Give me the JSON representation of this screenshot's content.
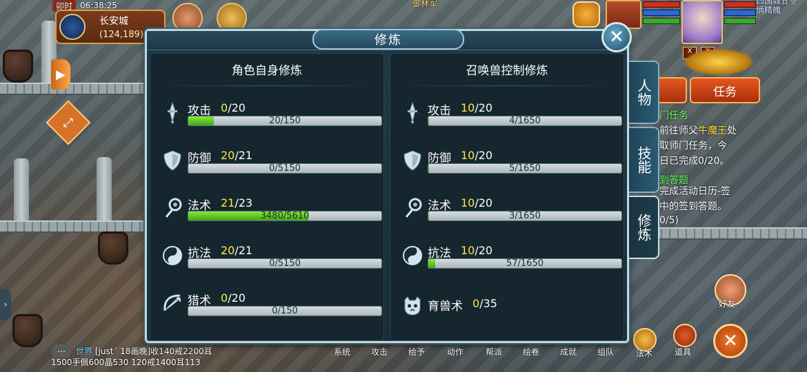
{
  "hud": {
    "shichen": "卯时",
    "clock": "06:38:25",
    "city": "长安城",
    "coords": "(124,189)",
    "top_mid_text": "御林军",
    "top_right_text_1": "四国城甘冬",
    "top_right_text_2": "炳精魄"
  },
  "quests": {
    "task_tab": "任务",
    "q1_title": "门任务",
    "q1_l1_a": "前往师父",
    "q1_l1_npc": "牛魔王",
    "q1_l1_b": "处",
    "q1_l2": "取师门任务，今",
    "q1_l3": "日已完成0/20。",
    "q2_title": "到答题",
    "q2_l1": "完成活动日历-签",
    "q2_l2": "中的签到答题。",
    "q2_l3": "0/5)"
  },
  "friend_label": "好友",
  "bottom": {
    "chat_icon": "…",
    "chat_channel": "世界",
    "chat_line1": "[just´  18画晚]收140戒2200耳",
    "chat_line2": "1500手佩600晶530 120戒1400耳113",
    "buttons": [
      "系统",
      "攻击",
      "给予",
      "动作",
      "帮派",
      "绘卷",
      "成就",
      "组队",
      "法术",
      "道具"
    ]
  },
  "panel": {
    "title": "修炼",
    "close_glyph": "✕",
    "side_tabs": [
      "人物",
      "技能",
      "修炼"
    ],
    "left": {
      "title": "角色自身修炼",
      "rows": [
        {
          "name": "攻击",
          "cur": "0",
          "max": "/20",
          "progress": "20/150",
          "fraction": 0.133,
          "icon": "sword-icon"
        },
        {
          "name": "防御",
          "cur": "20",
          "max": "/21",
          "progress": "0/5150",
          "fraction": 0.0,
          "icon": "shield-icon"
        },
        {
          "name": "法术",
          "cur": "21",
          "max": "/23",
          "progress": "3480/5610",
          "fraction": 0.62,
          "icon": "magic-swirl-icon"
        },
        {
          "name": "抗法",
          "cur": "20",
          "max": "/21",
          "progress": "0/5150",
          "fraction": 0.0,
          "icon": "yin-yang-icon"
        },
        {
          "name": "猎术",
          "cur": "0",
          "max": "/20",
          "progress": "0/150",
          "fraction": 0.0,
          "icon": "bow-icon"
        }
      ]
    },
    "right": {
      "title": "召唤兽控制修炼",
      "rows": [
        {
          "name": "攻击",
          "cur": "10",
          "max": "/20",
          "progress": "4/1650",
          "fraction": 0.002,
          "icon": "sword-icon"
        },
        {
          "name": "防御",
          "cur": "10",
          "max": "/20",
          "progress": "5/1650",
          "fraction": 0.003,
          "icon": "shield-icon"
        },
        {
          "name": "法术",
          "cur": "10",
          "max": "/20",
          "progress": "3/1650",
          "fraction": 0.002,
          "icon": "magic-swirl-icon"
        },
        {
          "name": "抗法",
          "cur": "10",
          "max": "/20",
          "progress": "57/1650",
          "fraction": 0.035,
          "icon": "yin-yang-icon"
        },
        {
          "name": "育兽术",
          "cur": "0",
          "max": "/35",
          "progress": "",
          "fraction": null,
          "icon": "beast-skull-icon"
        }
      ]
    }
  },
  "colors": {
    "panel_bg": "#1f3a46",
    "progress_fill": "#5fc82a",
    "level_highlight": "#ffe84a",
    "npc_highlight": "#ffe13a",
    "quest_title": "#6bff5a"
  }
}
